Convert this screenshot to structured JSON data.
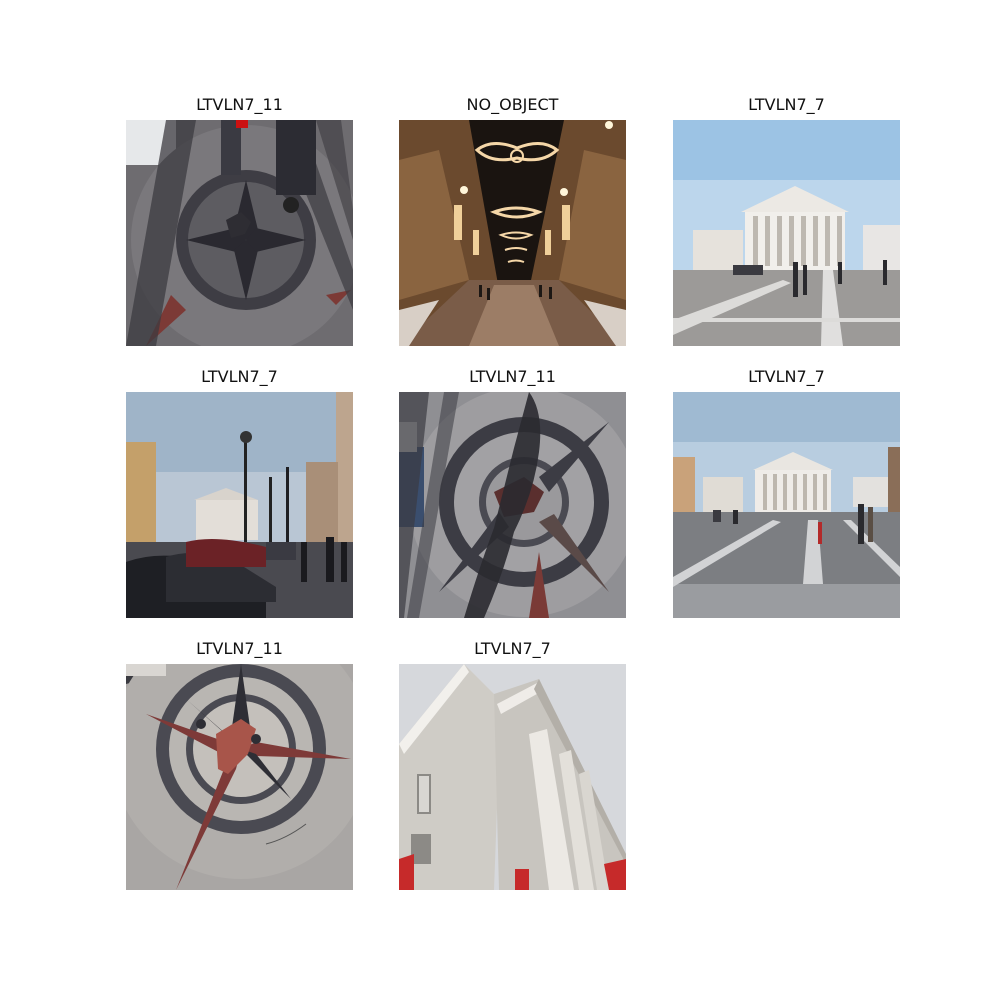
{
  "figure": {
    "panels": [
      {
        "title": "LTVLN7_11",
        "subject": "compass-rose-paving-with-shadows-icon"
      },
      {
        "title": "NO_OBJECT",
        "subject": "night-street-christmas-lights-icon"
      },
      {
        "title": "LTVLN7_7",
        "subject": "town-hall-square-daylight-icon"
      },
      {
        "title": "LTVLN7_7",
        "subject": "street-with-parked-cars-and-town-hall-icon"
      },
      {
        "title": "LTVLN7_11",
        "subject": "compass-rose-with-person-shadow-icon"
      },
      {
        "title": "LTVLN7_7",
        "subject": "town-hall-square-wide-icon"
      },
      {
        "title": "LTVLN7_11",
        "subject": "compass-rose-close-up-icon"
      },
      {
        "title": "LTVLN7_7",
        "subject": "town-hall-portico-low-angle-icon"
      }
    ]
  }
}
